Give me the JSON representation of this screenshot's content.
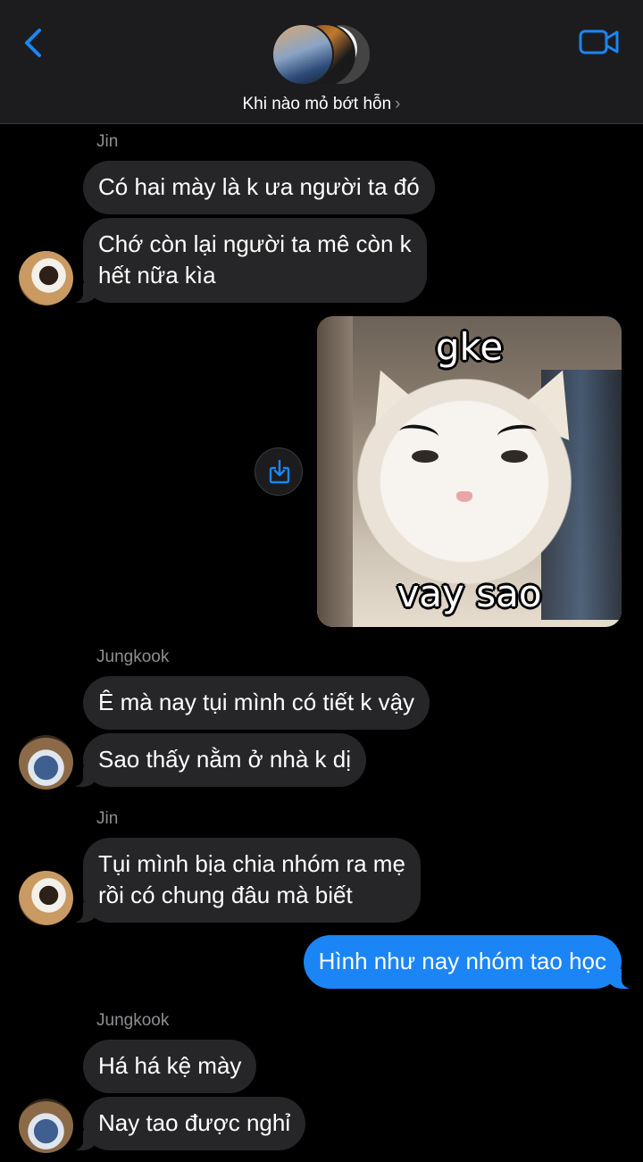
{
  "header": {
    "title": "Khi nào mỏ bớt hỗn",
    "chevron": "›",
    "back_icon": "chevron-left-icon",
    "video_icon": "video-camera-icon",
    "accent": "#1b85f6"
  },
  "messages": [
    {
      "sender": "Jin"
    },
    {
      "text": "Có hai mày là k ưa người ta đó"
    },
    {
      "line1": "Chớ còn lại người ta mê còn k",
      "line2": "hết nữa kìa"
    },
    {
      "image": {
        "top_caption": "gke",
        "bottom_caption": "vay sao"
      }
    },
    {
      "sender": "Jungkook"
    },
    {
      "text": "Ê mà nay tụi mình có tiết k vậy"
    },
    {
      "text": "Sao thấy nằm ở nhà k dị"
    },
    {
      "sender": "Jin"
    },
    {
      "line1": "Tụi mình bịa chia nhóm ra mẹ",
      "line2": "rồi có chung đâu mà biết"
    },
    {
      "text": "Hình như nay nhóm tao học",
      "outgoing": true
    },
    {
      "sender": "Jungkook"
    },
    {
      "text": "Há há kệ mày"
    },
    {
      "text": "Nay tao được nghỉ"
    }
  ],
  "colors": {
    "incoming_bubble": "#262628",
    "outgoing_bubble": "#1b85f6",
    "background": "#000000"
  }
}
